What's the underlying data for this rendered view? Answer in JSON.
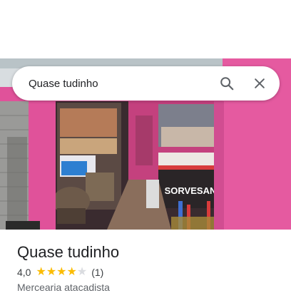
{
  "search": {
    "value": "Quase tudinho"
  },
  "icons": {
    "search": "search-icon",
    "close": "close-icon"
  },
  "place": {
    "name": "Quase tudinho",
    "rating": "4,0",
    "stars_filled": 4,
    "stars_total": 5,
    "review_count": "(1)",
    "category": "Mercearia atacadista"
  },
  "photo": {
    "sign_text": "SORVESAN"
  },
  "colors": {
    "wall_pink": "#e0529a",
    "star": "#fbbc04",
    "star_empty": "#dadce0",
    "icon": "#5f6368"
  }
}
